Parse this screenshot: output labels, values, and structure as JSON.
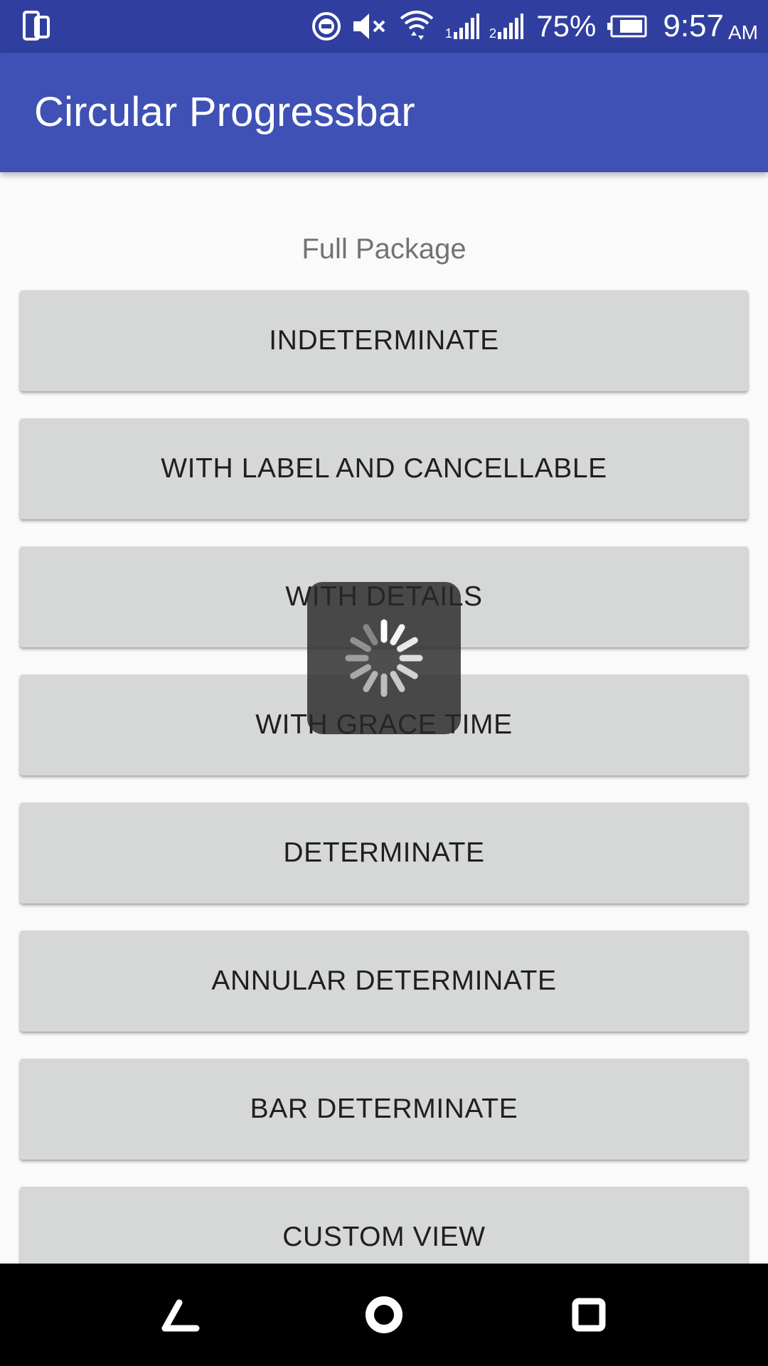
{
  "status_bar": {
    "left_icon": "screen-rotation-icon",
    "icons": [
      "do-not-disturb-icon",
      "volume-mute-icon",
      "wifi-icon",
      "signal-sim1-icon",
      "signal-sim2-icon",
      "battery-icon"
    ],
    "battery_percent": "75%",
    "time": "9:57",
    "ampm": "AM",
    "background": "#303f9f"
  },
  "app_bar": {
    "title": "Circular Progressbar",
    "background": "#3f51b5"
  },
  "main": {
    "section_title": "Full Package",
    "buttons": [
      {
        "label": "INDETERMINATE"
      },
      {
        "label": "WITH LABEL AND CANCELLABLE"
      },
      {
        "label": "WITH DETAILS"
      },
      {
        "label": "WITH GRACE TIME"
      },
      {
        "label": "DETERMINATE"
      },
      {
        "label": "ANNULAR DETERMINATE"
      },
      {
        "label": "BAR DETERMINATE"
      },
      {
        "label": "CUSTOM VIEW"
      }
    ]
  },
  "progress_hud": {
    "icon": "spinner-icon",
    "state": "indeterminate"
  },
  "nav_bar": {
    "icons": [
      "back-icon",
      "home-icon",
      "recents-icon"
    ]
  }
}
